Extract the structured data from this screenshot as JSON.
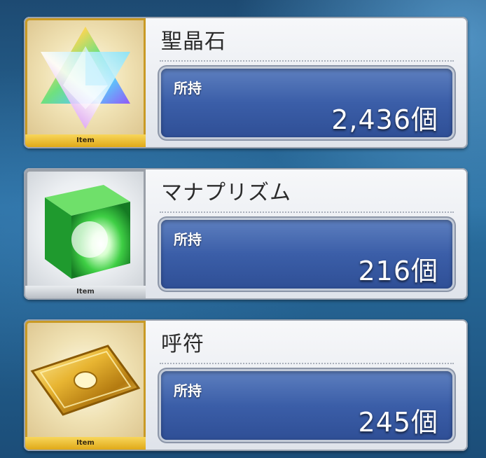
{
  "items": [
    {
      "name": "聖晶石",
      "count_label": "所持",
      "count_value": "2,436個",
      "rarity_label": "Item",
      "frame": "gold",
      "icon": "saint-quartz-icon"
    },
    {
      "name": "マナプリズム",
      "count_label": "所持",
      "count_value": "216個",
      "rarity_label": "Item",
      "frame": "silver",
      "icon": "mana-prism-icon"
    },
    {
      "name": "呼符",
      "count_label": "所持",
      "count_value": "245個",
      "rarity_label": "Item",
      "frame": "gold",
      "icon": "summon-ticket-icon"
    }
  ],
  "colors": {
    "panel_bg": "#eef0f4",
    "count_box": "#3b5ea8",
    "gold_frame": "#e0a918",
    "silver_frame": "#b9bec5"
  }
}
